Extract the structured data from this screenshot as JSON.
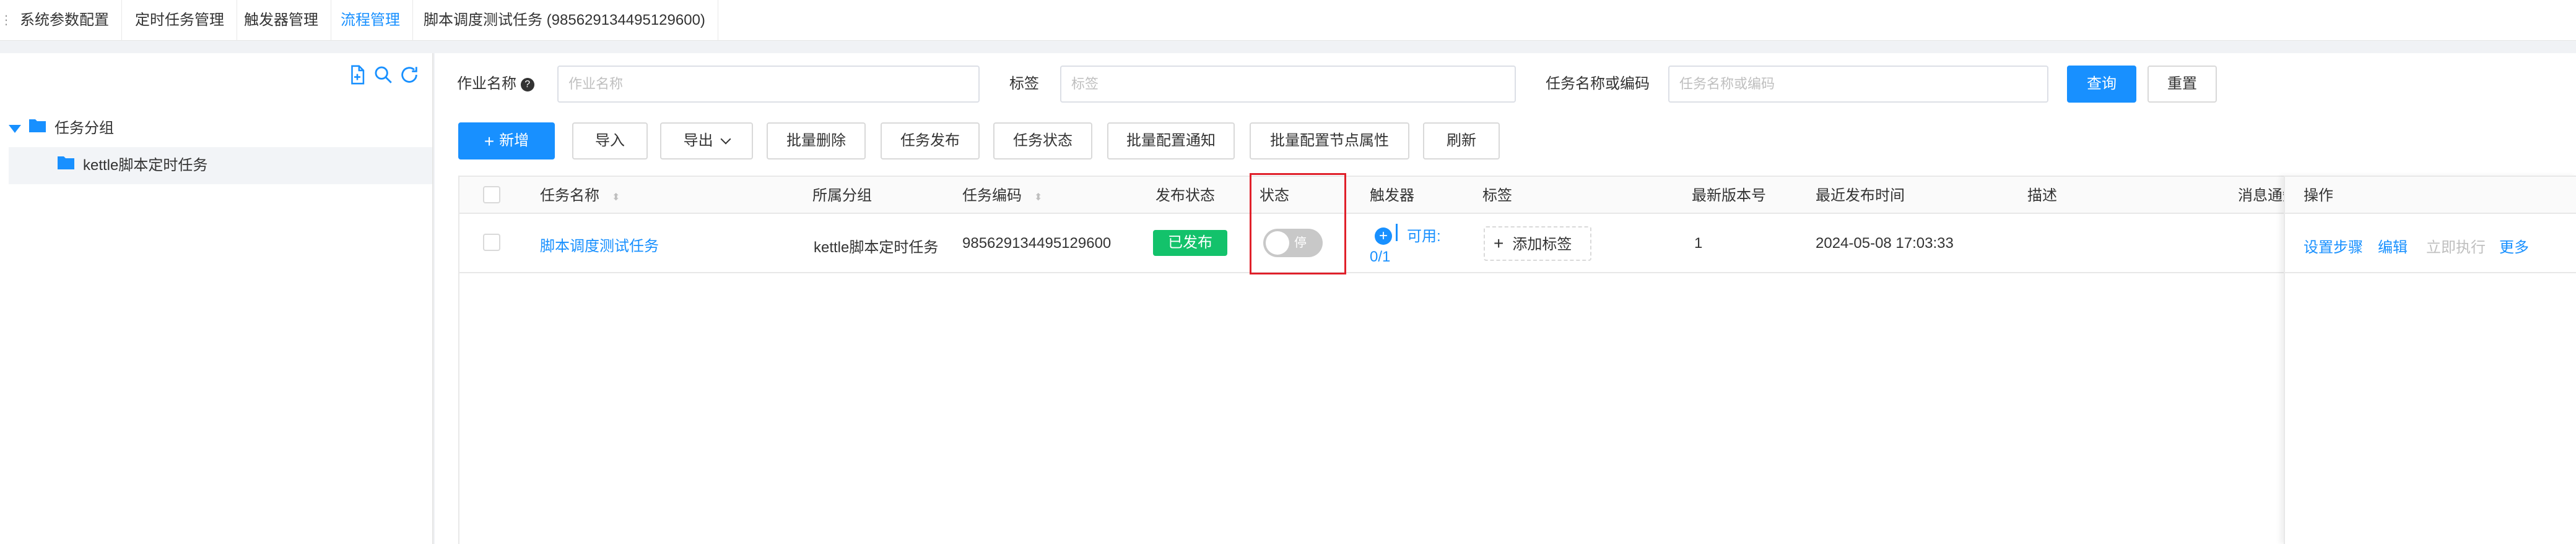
{
  "tabs": [
    {
      "label": "系统参数配置",
      "active": false
    },
    {
      "label": "定时任务管理",
      "active": false
    },
    {
      "label": "触发器管理",
      "active": false
    },
    {
      "label": "流程管理",
      "active": true
    },
    {
      "label": "脚本调度测试任务 (985629134495129600)",
      "active": false
    }
  ],
  "sidebar": {
    "tree": [
      {
        "label": "任务分组",
        "expanded": true
      },
      {
        "label": "kettle脚本定时任务",
        "selected": true
      }
    ]
  },
  "filters": {
    "job_name_label": "作业名称",
    "job_name_placeholder": "作业名称",
    "tag_label": "标签",
    "tag_placeholder": "标签",
    "task_label": "任务名称或编码",
    "task_placeholder": "任务名称或编码",
    "query": "查询",
    "reset": "重置"
  },
  "toolbar": {
    "add": "新增",
    "import": "导入",
    "export": "导出",
    "batch_delete": "批量删除",
    "publish": "任务发布",
    "status": "任务状态",
    "batch_notify": "批量配置通知",
    "batch_node": "批量配置节点属性",
    "refresh": "刷新"
  },
  "table": {
    "headers": {
      "name": "任务名称",
      "group": "所属分组",
      "code": "任务编码",
      "publish_status": "发布状态",
      "status": "状态",
      "trigger": "触发器",
      "tag": "标签",
      "version": "最新版本号",
      "publish_time": "最近发布时间",
      "desc": "描述",
      "notify": "消息通知",
      "ops": "操作"
    },
    "rows": [
      {
        "name": "脚本调度测试任务",
        "group": "kettle脚本定时任务",
        "code": "985629134495129600",
        "publish_status": "已发布",
        "toggle_label": "停",
        "trigger_available": "可用:",
        "trigger_count": "0/1",
        "add_tag": "添加标签",
        "version": "1",
        "publish_time": "2024-05-08 17:03:33",
        "ops": {
          "steps": "设置步骤",
          "edit": "编辑",
          "run": "立即执行",
          "more": "更多"
        }
      }
    ]
  },
  "colors": {
    "primary": "#1890ff",
    "published": "#13c26b",
    "highlight": "#e0202a"
  }
}
